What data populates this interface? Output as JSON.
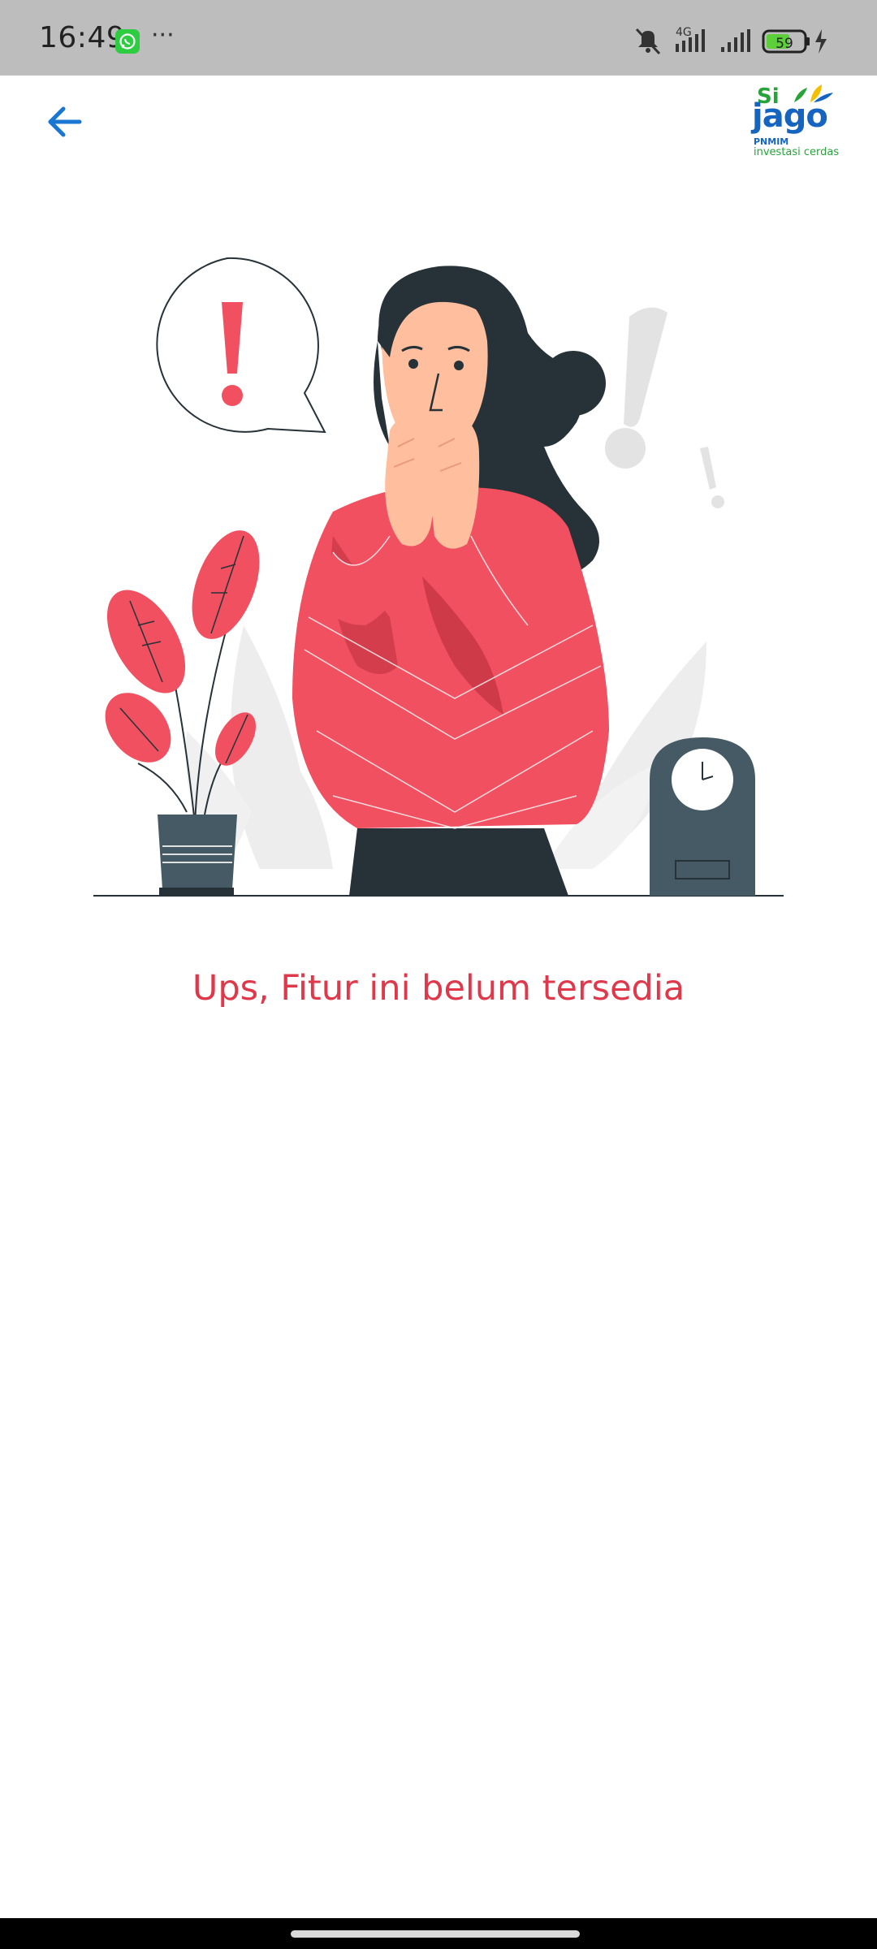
{
  "status_bar": {
    "time": "16:49",
    "more": "···",
    "network_label": "4G",
    "battery_level": "59",
    "icons": [
      "whatsapp-icon",
      "mute-icon",
      "signal-icon",
      "signal-icon",
      "battery-icon",
      "charging-icon"
    ]
  },
  "header": {
    "back_icon": "arrow-left-icon",
    "logo": {
      "si": "Si",
      "jago": "jago",
      "company": "PNMIM",
      "tagline": "investasi cerdas"
    }
  },
  "content": {
    "illustration": "surprised-woman-illustration",
    "message": "Ups, Fitur ini belum tersedia"
  },
  "colors": {
    "accent_blue": "#1976d2",
    "message_red": "#e0384b",
    "status_bar_bg": "#bdbdbd",
    "illustration_red": "#f05060",
    "illustration_dark": "#263238"
  }
}
